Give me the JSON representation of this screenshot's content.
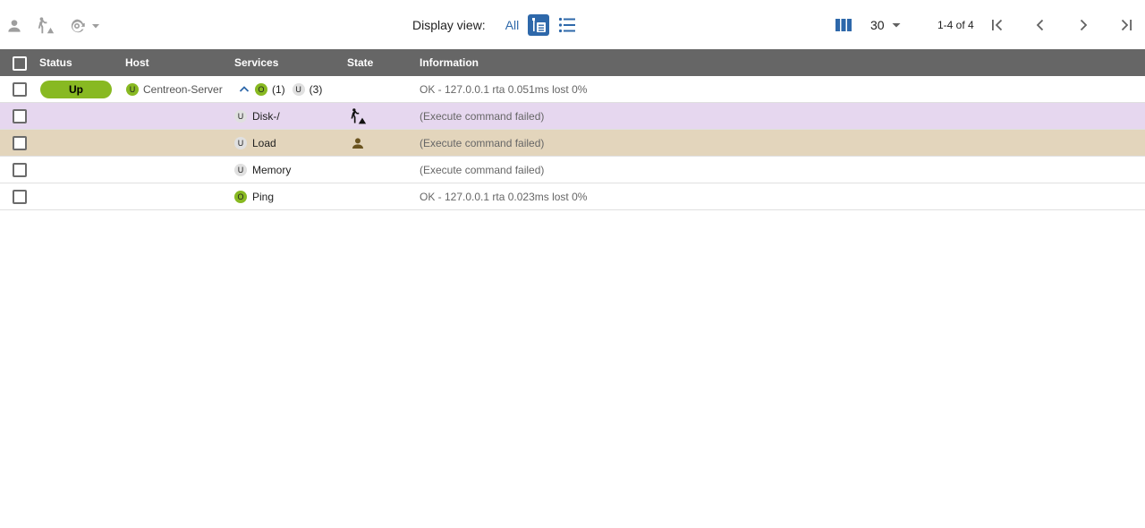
{
  "toolbar": {
    "icons": [
      "acknowledge-icon",
      "downtime-icon",
      "check-icon",
      "dropdown-caret-icon"
    ],
    "display_view_label": "Display view:",
    "view_all_label": "All",
    "view_modes": [
      "tree-view-icon",
      "list-view-icon"
    ],
    "per_page": "30",
    "pagination_info": "1-4 of 4"
  },
  "columns": [
    "Status",
    "Host",
    "Services",
    "State",
    "Information"
  ],
  "rows": [
    {
      "status": "Up",
      "host_badge": "U",
      "host": "Centreon-Server",
      "ok_badge": "O",
      "ok_count": "(1)",
      "unk_badge": "U",
      "unk_count": "(3)",
      "information": "OK - 127.0.0.1 rta 0.051ms lost 0%",
      "row_color": "#ffffff"
    },
    {
      "badge": "U",
      "service": "Disk-/",
      "state_icon": "downtime-icon",
      "information": "(Execute command failed)",
      "row_color": "#E6D7EF"
    },
    {
      "badge": "U",
      "service": "Load",
      "state_icon": "acknowledge-icon",
      "information": "(Execute command failed)",
      "row_color": "#E3D5BC"
    },
    {
      "badge": "U",
      "service": "Memory",
      "state_icon": "",
      "information": "(Execute command failed)",
      "row_color": "#ffffff"
    },
    {
      "badge": "O",
      "service": "Ping",
      "state_icon": "",
      "information": "OK - 127.0.0.1 rta 0.023ms lost 0%",
      "row_color": "#ffffff"
    }
  ],
  "colors": {
    "accent": "#2E68AA",
    "ok": "#88B922",
    "unknown": "#E0E0E0",
    "header_bg": "#666666",
    "downtime_row": "#E6D7EF",
    "acknowledged_row": "#E3D5BC"
  }
}
